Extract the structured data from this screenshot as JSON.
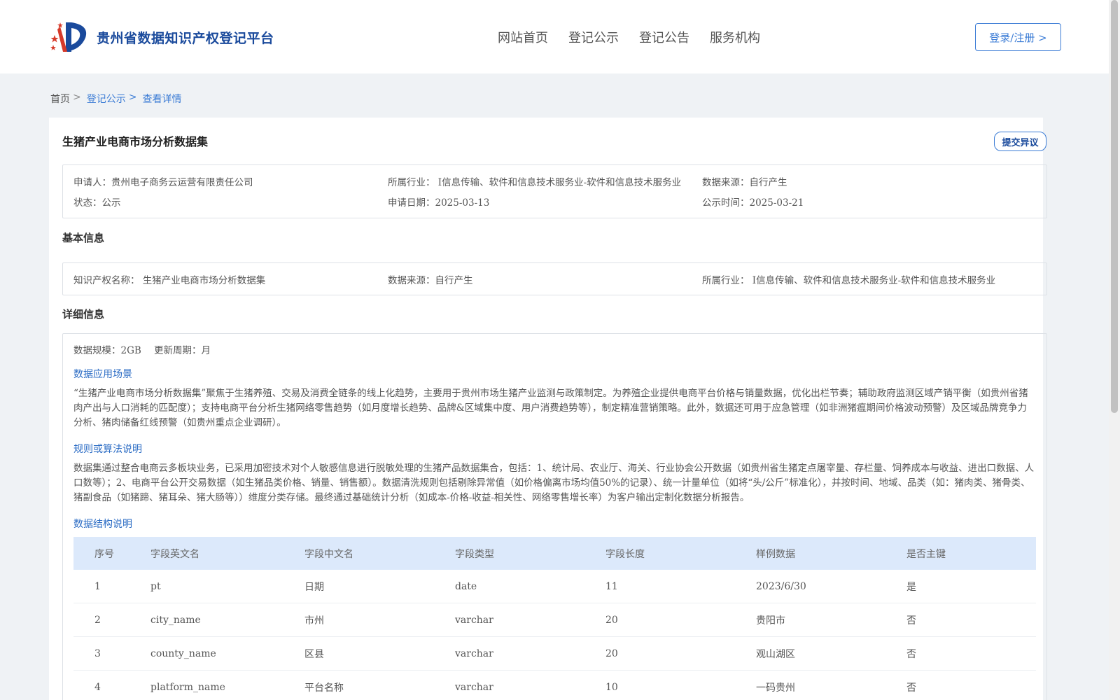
{
  "header": {
    "site_title": "贵州省数据知识产权登记平台",
    "nav": [
      "网站首页",
      "登记公示",
      "登记公告",
      "服务机构"
    ],
    "login_label": "登录/注册 >"
  },
  "breadcrumb": {
    "home": "首页",
    "sep": ">",
    "list": "登记公示",
    "current": "查看详情"
  },
  "dataset": {
    "title": "生猪产业电商市场分析数据集",
    "objection_label": "提交异议",
    "summary": {
      "applicant": "申请人：贵州电子商务云运营有限责任公司",
      "industry": "所属行业： I信息传输、软件和信息技术服务业-软件和信息技术服务业",
      "source": "数据来源：自行产生",
      "status": "状态：公示",
      "apply_date": "申请日期：2025-03-13",
      "publish_date": "公示时间：2025-03-21"
    }
  },
  "basic": {
    "heading": "基本信息",
    "ip_name": "知识产权名称： 生猪产业电商市场分析数据集",
    "source": "数据来源：自行产生",
    "industry": "所属行业： I信息传输、软件和信息技术服务业-软件和信息技术服务业"
  },
  "detail": {
    "heading": "详细信息",
    "scale": "数据规模：2GB",
    "cycle": "更新周期：月",
    "scenario_title": "数据应用场景",
    "scenario_text": "“生猪产业电商市场分析数据集”聚焦于生猪养殖、交易及消费全链条的线上化趋势，主要用于贵州市场生猪产业监测与政策制定。为养殖企业提供电商平台价格与销量数据，优化出栏节奏；辅助政府监测区域产销平衡（如贵州省猪肉产出与人口消耗的匹配度）；支持电商平台分析生猪网络零售趋势（如月度增长趋势、品牌&区域集中度、用户消费趋势等），制定精准营销策略。此外，数据还可用于应急管理（如非洲猪瘟期间价格波动预警）及区域品牌竞争力分析、猪肉储备红线预警（如贵州重点企业调研）。",
    "rules_title": "规则或算法说明",
    "rules_text": "数据集通过整合电商云多板块业务，已采用加密技术对个人敏感信息进行脱敏处理的生猪产品数据集合，包括：1、统计局、农业厅、海关、行业协会公开数据（如贵州省生猪定点屠宰量、存栏量、饲养成本与收益、进出口数据、人口数等）；2、电商平台公开交易数据（如生猪品类价格、销量、销售额）。数据清洗规则包括剔除异常值（如价格偏离市场均值50%的记录）、统一计量单位（如将“头/公斤”标准化），并按时间、地域、品类（如：猪肉类、猪骨类、猪副食品（如猪蹄、猪耳朵、猪大肠等））维度分类存储。最终通过基础统计分析（如成本-价格-收益-相关性、网络零售增长率）为客户输出定制化数据分析报告。",
    "structure_title": "数据结构说明"
  },
  "table": {
    "headers": [
      "序号",
      "字段英文名",
      "字段中文名",
      "字段类型",
      "字段长度",
      "样例数据",
      "是否主键"
    ],
    "rows": [
      [
        "1",
        "pt",
        "日期",
        "date",
        "11",
        "2023/6/30",
        "是"
      ],
      [
        "2",
        "city_name",
        "市州",
        "varchar",
        "20",
        "贵阳市",
        "否"
      ],
      [
        "3",
        "county_name",
        "区县",
        "varchar",
        "20",
        "观山湖区",
        "否"
      ],
      [
        "4",
        "platform_name",
        "平台名称",
        "varchar",
        "10",
        "一码贵州",
        "否"
      ]
    ]
  },
  "colors": {
    "accent": "#3a7bd5",
    "brand": "#1a4a9c",
    "table_header": "#dce9fb"
  }
}
